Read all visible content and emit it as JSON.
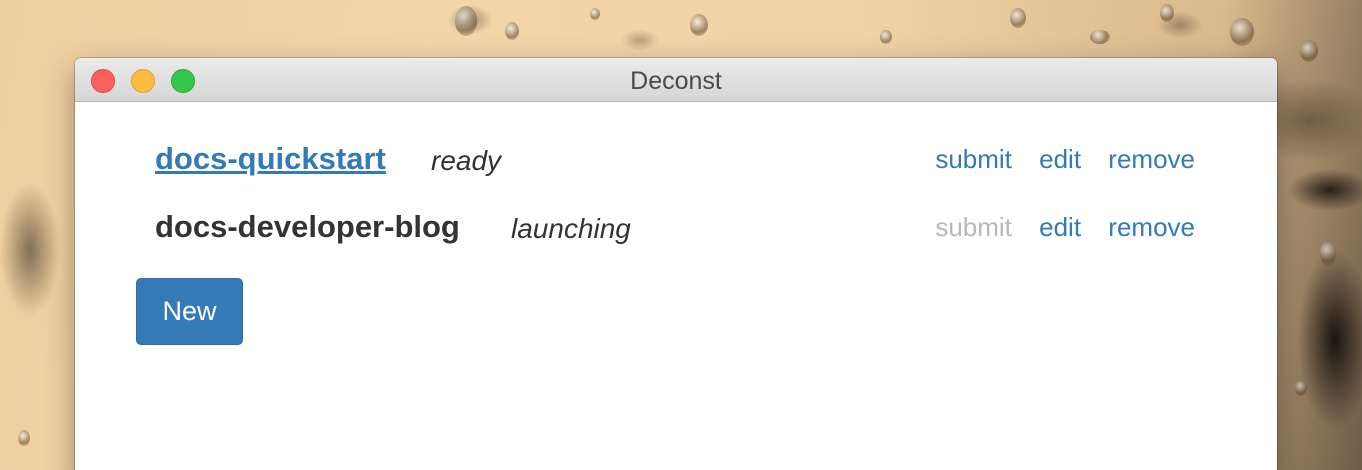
{
  "window": {
    "title": "Deconst"
  },
  "sites": [
    {
      "name": "docs-quickstart",
      "status": "ready",
      "actions": {
        "submit": "submit",
        "edit": "edit",
        "remove": "remove"
      }
    },
    {
      "name": "docs-developer-blog",
      "status": "launching",
      "actions": {
        "submit": "submit",
        "edit": "edit",
        "remove": "remove"
      }
    }
  ],
  "new_button": {
    "label": "New"
  },
  "colors": {
    "link": "#337ab7",
    "disabled": "#b8b8b8",
    "text": "#333333",
    "button_bg": "#337ab7"
  }
}
